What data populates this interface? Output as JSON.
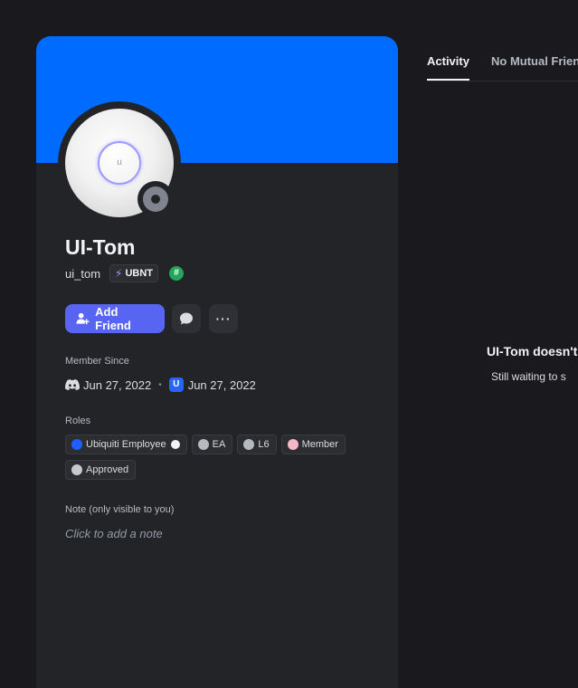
{
  "profile": {
    "display_name": "UI-Tom",
    "username": "ui_tom",
    "tag_label": "UBNT",
    "hash_badge": "#",
    "avatar_mark": "u",
    "status": "offline",
    "colors": {
      "banner": "#006cff",
      "accent_button": "#5865f2"
    }
  },
  "actions": {
    "add_friend_label": "Add Friend",
    "message_icon": "chat-bubble-icon",
    "more_label": "···"
  },
  "member_since": {
    "title": "Member Since",
    "discord_date": "Jun 27, 2022",
    "separator": "•",
    "server_date": "Jun 27, 2022",
    "server_icon_text": "U"
  },
  "roles": {
    "title": "Roles",
    "items": [
      {
        "label": "Ubiquiti Employee",
        "color": "#1f5fff",
        "trailing_dot": true
      },
      {
        "label": "EA",
        "color": "#b5bac1"
      },
      {
        "label": "L6",
        "color": "#b5bac1"
      },
      {
        "label": "Member",
        "color": "#f5b6c6"
      },
      {
        "label": "Approved",
        "color": "#c4c9ce"
      }
    ]
  },
  "note": {
    "title": "Note (only visible to you)",
    "placeholder": "Click to add a note"
  },
  "tabs": [
    {
      "label": "Activity",
      "active": true
    },
    {
      "label": "No Mutual Frien"
    }
  ],
  "activity": {
    "empty_title": "UI-Tom doesn't",
    "empty_subtitle": "Still waiting to s"
  }
}
